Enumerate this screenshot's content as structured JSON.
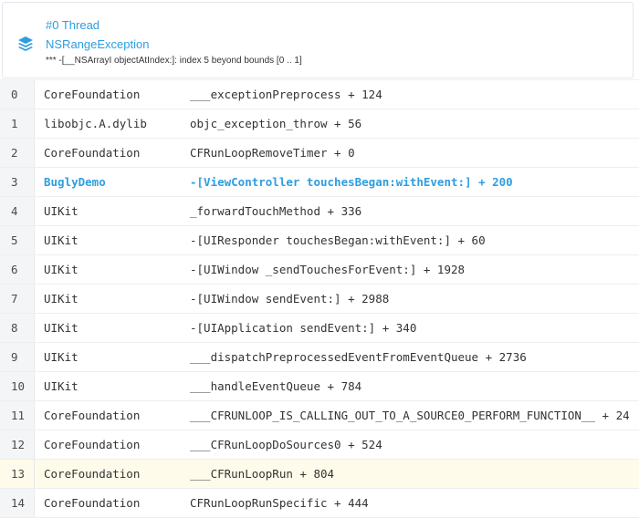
{
  "header": {
    "icon": "stack-layers-icon",
    "accent_color": "#2d9ee0",
    "thread": "#0 Thread",
    "exception_name": "NSRangeException",
    "reason": "*** -[__NSArrayI objectAtIndex:]: index 5 beyond bounds [0 .. 1]"
  },
  "frames": [
    {
      "num": "0",
      "lib": "CoreFoundation",
      "symbol": "___exceptionPreprocess + 124",
      "app": false,
      "highlight": false
    },
    {
      "num": "1",
      "lib": "libobjc.A.dylib",
      "symbol": "objc_exception_throw + 56",
      "app": false,
      "highlight": false
    },
    {
      "num": "2",
      "lib": "CoreFoundation",
      "symbol": "CFRunLoopRemoveTimer + 0",
      "app": false,
      "highlight": false
    },
    {
      "num": "3",
      "lib": "BuglyDemo",
      "symbol": "-[ViewController touchesBegan:withEvent:] + 200",
      "app": true,
      "highlight": false
    },
    {
      "num": "4",
      "lib": "UIKit",
      "symbol": "_forwardTouchMethod + 336",
      "app": false,
      "highlight": false
    },
    {
      "num": "5",
      "lib": "UIKit",
      "symbol": "-[UIResponder touchesBegan:withEvent:] + 60",
      "app": false,
      "highlight": false
    },
    {
      "num": "6",
      "lib": "UIKit",
      "symbol": "-[UIWindow _sendTouchesForEvent:] + 1928",
      "app": false,
      "highlight": false
    },
    {
      "num": "7",
      "lib": "UIKit",
      "symbol": "-[UIWindow sendEvent:] + 2988",
      "app": false,
      "highlight": false
    },
    {
      "num": "8",
      "lib": "UIKit",
      "symbol": "-[UIApplication sendEvent:] + 340",
      "app": false,
      "highlight": false
    },
    {
      "num": "9",
      "lib": "UIKit",
      "symbol": "___dispatchPreprocessedEventFromEventQueue + 2736",
      "app": false,
      "highlight": false
    },
    {
      "num": "10",
      "lib": "UIKit",
      "symbol": "___handleEventQueue + 784",
      "app": false,
      "highlight": false
    },
    {
      "num": "11",
      "lib": "CoreFoundation",
      "symbol": "___CFRUNLOOP_IS_CALLING_OUT_TO_A_SOURCE0_PERFORM_FUNCTION__ + 24",
      "app": false,
      "highlight": false
    },
    {
      "num": "12",
      "lib": "CoreFoundation",
      "symbol": "___CFRunLoopDoSources0 + 524",
      "app": false,
      "highlight": false
    },
    {
      "num": "13",
      "lib": "CoreFoundation",
      "symbol": "___CFRunLoopRun + 804",
      "app": false,
      "highlight": true
    },
    {
      "num": "14",
      "lib": "CoreFoundation",
      "symbol": "CFRunLoopRunSpecific + 444",
      "app": false,
      "highlight": false
    }
  ]
}
